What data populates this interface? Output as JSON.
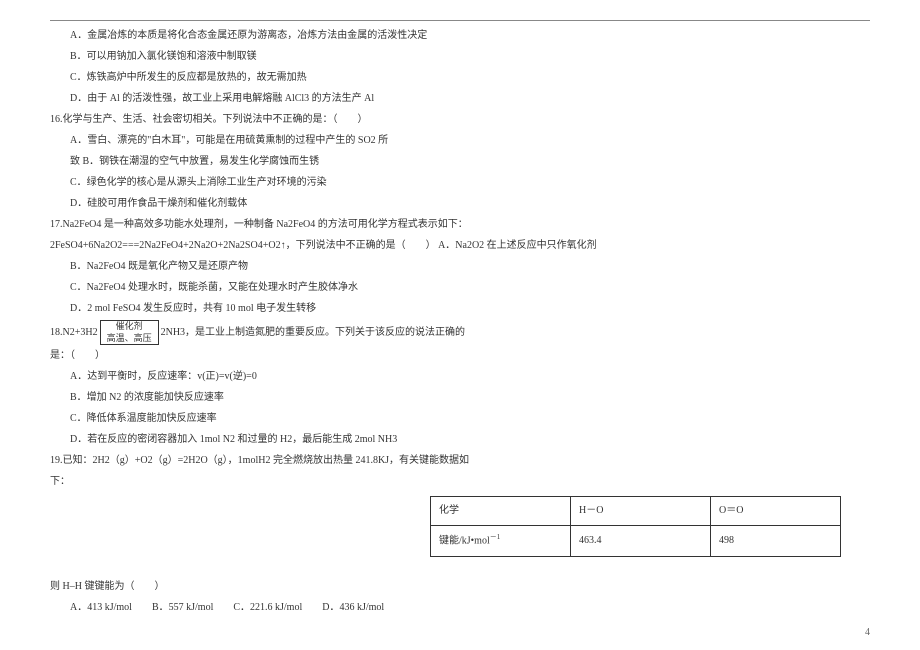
{
  "options_15": {
    "A": "A．金属冶炼的本质是将化合态金属还原为游离态，冶炼方法由金属的活泼性决定",
    "B": "B．可以用钠加入氯化镁饱和溶液中制取镁",
    "C": "C．炼铁高炉中所发生的反应都是放热的，故无需加热",
    "D": "D．由于 Al 的活泼性强，故工业上采用电解熔融 AlCl3 的方法生产 Al"
  },
  "q16": {
    "stem": "16.化学与生产、生活、社会密切相关。下列说法中不正确的是：（　　）",
    "A": "A．雪白、漂亮的\"白木耳\"，可能是在用硫黄熏制的过程中产生的 SO2 所",
    "A2": "致 B．钢铁在潮湿的空气中放置，易发生化学腐蚀而生锈",
    "C": "C．绿色化学的核心是从源头上消除工业生产对环境的污染",
    "D": "D．硅胶可用作食品干燥剂和催化剂载体"
  },
  "q17": {
    "stem": "17.Na2FeO4 是一种高效多功能水处理剂，一种制备 Na2FeO4 的方法可用化学方程式表示如下：",
    "eq": "2FeSO4+6Na2O2===2Na2FeO4+2Na2O+2Na2SO4+O2↑，下列说法中不正确的是（　　） A．Na2O2 在上述反应中只作氧化剂",
    "B": "B．Na2FeO4 既是氧化产物又是还原产物",
    "C": "C．Na2FeO4 处理水时，既能杀菌，又能在处理水时产生胶体净水",
    "D": "D．2 mol FeSO4 发生反应时，共有 10 mol 电子发生转移"
  },
  "q18": {
    "pre": "18.N2+3H2",
    "cat_top": "催化剂",
    "cat_bot": "高温、高压",
    "post": "2NH3，是工业上制造氮肥的重要反应。下列关于该反应的说法正确的",
    "post2": "是：（　　）",
    "A": "A．达到平衡时，反应速率：v(正)=v(逆)=0",
    "B": "B．增加 N2 的浓度能加快反应速率",
    "C": "C．降低体系温度能加快反应速率",
    "D": "D．若在反应的密闭容器加入 1mol N2 和过量的 H2，最后能生成 2mol NH3"
  },
  "q19": {
    "stem": "19.已知：2H2（g）+O2（g）=2H2O（g），1molH2 完全燃烧放出热量 241.8KJ，有关键能数据如",
    "stem2": "下：",
    "after": "则 H–H 键键能为（　　）",
    "options": "A．413 kJ/mol　　B．557 kJ/mol　　C．221.6 kJ/mol　　D．436 kJ/mol"
  },
  "table": {
    "r1c1": "化学",
    "r1c2": "H－O",
    "r1c3": "O＝O",
    "r2c1_html": "键能/kJ•mol",
    "r2c1_sup": "－1",
    "r2c2": "463.4",
    "r2c3": "498"
  },
  "page_number": "4"
}
